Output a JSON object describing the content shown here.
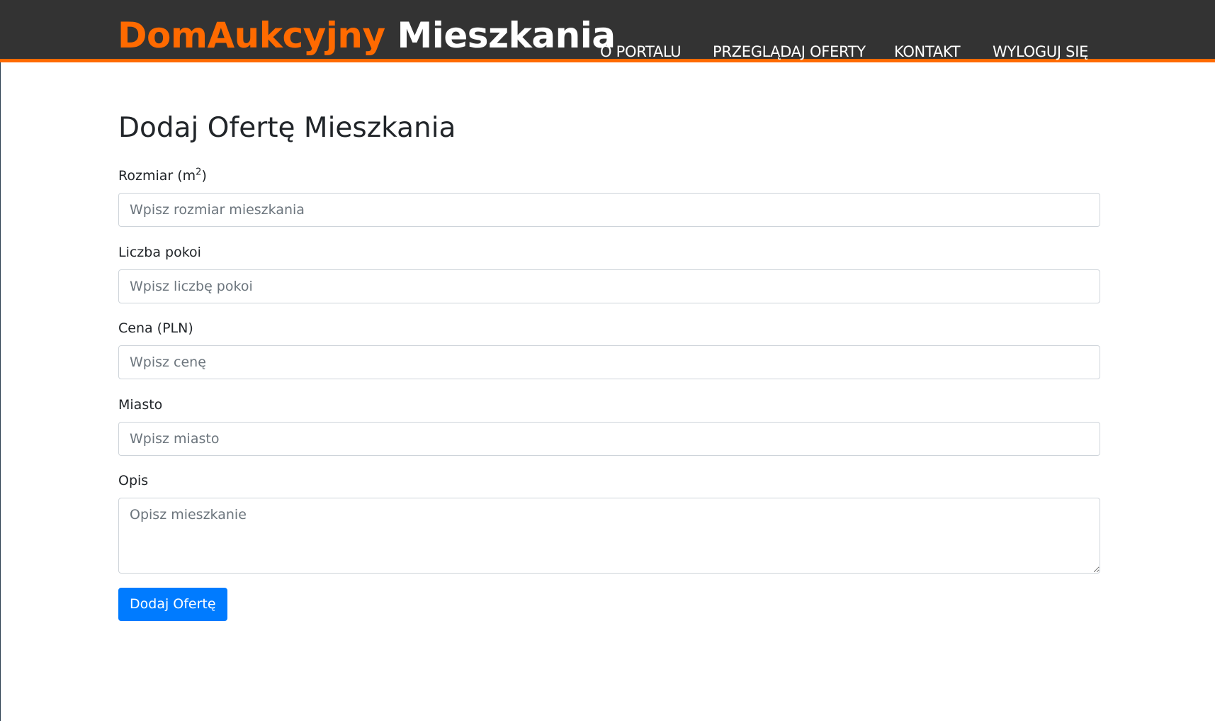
{
  "header": {
    "brand_part1": "DomAukcyjny",
    "brand_part2": "Mieszkania",
    "nav": [
      {
        "label": "O PORTALU"
      },
      {
        "label": "PRZEGLĄDAJ OFERTY"
      },
      {
        "label": "KONTAKT"
      },
      {
        "label": "WYLOGUJ SIĘ"
      }
    ]
  },
  "form": {
    "title": "Dodaj Ofertę Mieszkania",
    "size": {
      "label": "Rozmiar (m",
      "label_sup": "2",
      "label_end": ")",
      "placeholder": "Wpisz rozmiar mieszkania",
      "value": ""
    },
    "rooms": {
      "label": "Liczba pokoi",
      "placeholder": "Wpisz liczbę pokoi",
      "value": ""
    },
    "price": {
      "label": "Cena (PLN)",
      "placeholder": "Wpisz cenę",
      "value": ""
    },
    "city": {
      "label": "Miasto",
      "placeholder": "Wpisz miasto",
      "value": ""
    },
    "description": {
      "label": "Opis",
      "placeholder": "Opisz mieszkanie",
      "value": ""
    },
    "submit_label": "Dodaj Ofertę"
  },
  "colors": {
    "header_bg": "#333333",
    "accent": "#ff6a00",
    "button": "#007bff"
  }
}
